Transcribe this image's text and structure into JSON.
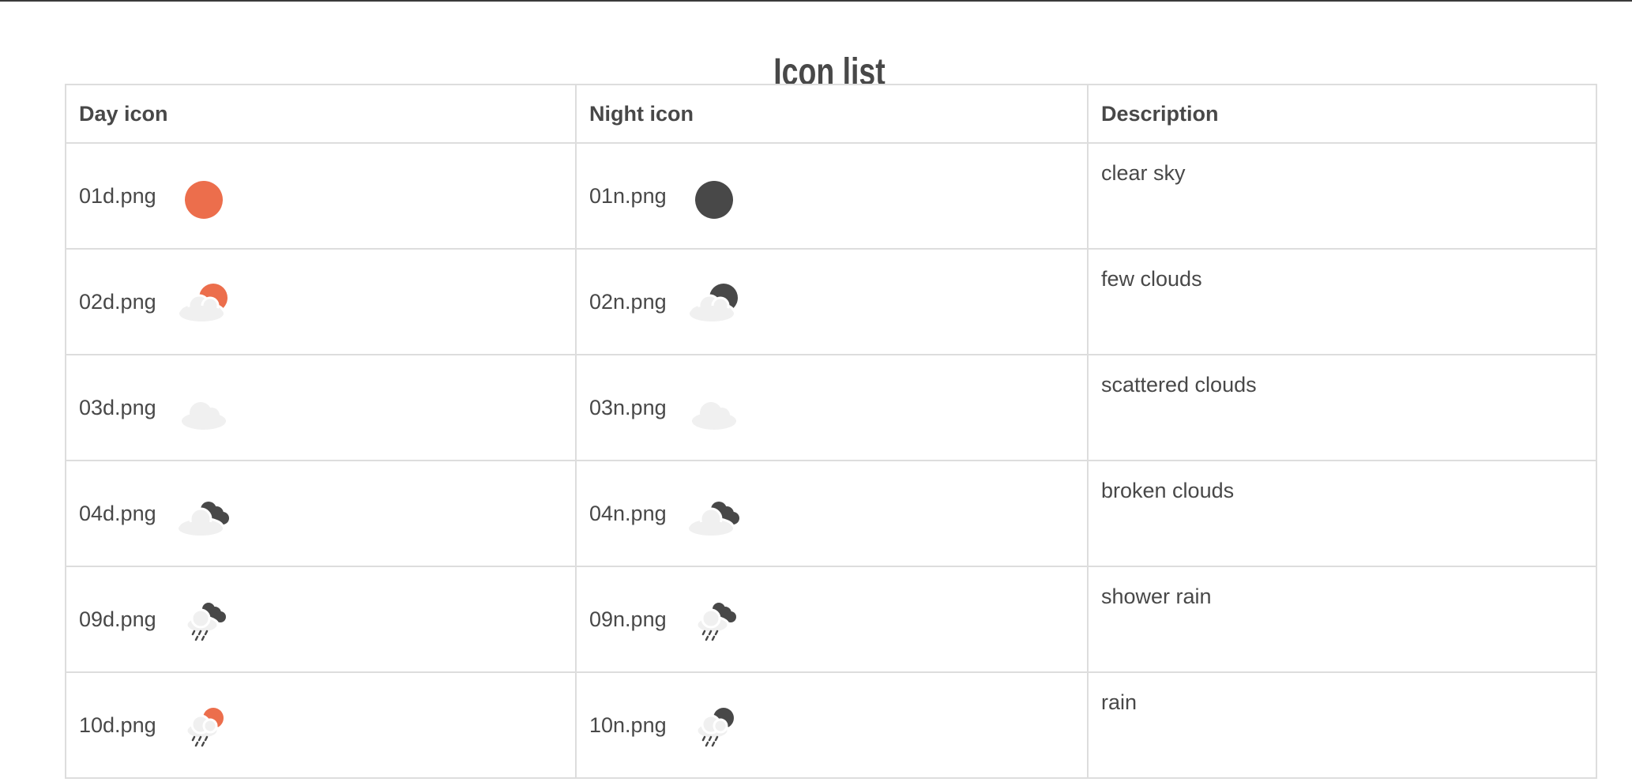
{
  "page": {
    "title": "Icon list"
  },
  "table": {
    "headers": {
      "day": "Day icon",
      "night": "Night icon",
      "description": "Description"
    },
    "rows": [
      {
        "day_file": "01d.png",
        "night_file": "01n.png",
        "description": "clear sky",
        "day_icon": "clear-sky-day-icon",
        "night_icon": "clear-sky-night-icon"
      },
      {
        "day_file": "02d.png",
        "night_file": "02n.png",
        "description": "few clouds",
        "day_icon": "few-clouds-day-icon",
        "night_icon": "few-clouds-night-icon"
      },
      {
        "day_file": "03d.png",
        "night_file": "03n.png",
        "description": "scattered clouds",
        "day_icon": "scattered-clouds-day-icon",
        "night_icon": "scattered-clouds-night-icon"
      },
      {
        "day_file": "04d.png",
        "night_file": "04n.png",
        "description": "broken clouds",
        "day_icon": "broken-clouds-day-icon",
        "night_icon": "broken-clouds-night-icon"
      },
      {
        "day_file": "09d.png",
        "night_file": "09n.png",
        "description": "shower rain",
        "day_icon": "shower-rain-day-icon",
        "night_icon": "shower-rain-night-icon"
      },
      {
        "day_file": "10d.png",
        "night_file": "10n.png",
        "description": "rain",
        "day_icon": "rain-day-icon",
        "night_icon": "rain-night-icon"
      }
    ]
  },
  "colors": {
    "sun": "#ec6e4c",
    "moon": "#484848",
    "cloud": "#f0f0f0",
    "dark_cloud": "#484848",
    "border": "#dddddd",
    "text": "#484848"
  }
}
